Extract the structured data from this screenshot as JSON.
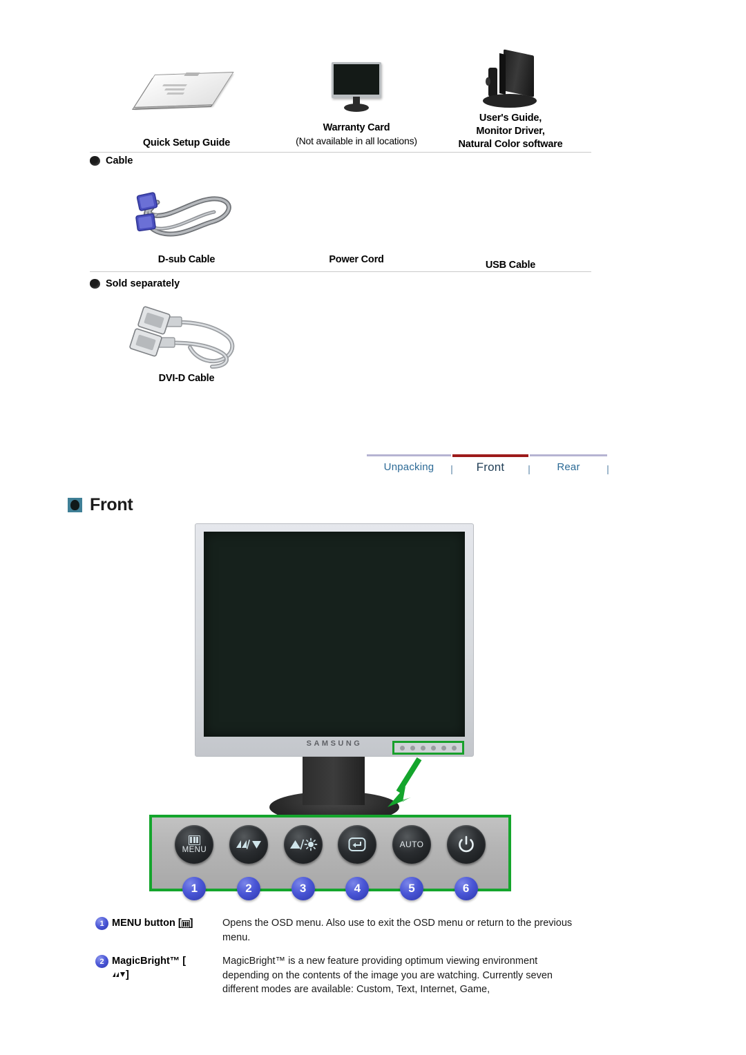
{
  "accessories": {
    "row1": [
      {
        "label": "Quick Setup Guide",
        "sub": "",
        "icon": "booklet-icon"
      },
      {
        "label": "Warranty Card",
        "sub": "(Not available in all locations)",
        "icon": "monitor-front-icon"
      },
      {
        "label": "User's Guide,\nMonitor Driver,\nNatural Color software",
        "sub": "",
        "icon": "monitor-angled-icon"
      }
    ],
    "row1_labels": {
      "quick_setup_guide": "Quick Setup Guide",
      "warranty_card": "Warranty Card",
      "warranty_card_note": "(Not available in all locations)",
      "users_guide_l1": "User's Guide,",
      "users_guide_l2": "Monitor Driver,",
      "users_guide_l3": "Natural Color software"
    },
    "cable_section": {
      "heading": "Cable",
      "items": {
        "dsub": "D-sub Cable",
        "power": "Power Cord",
        "usb": "USB Cable"
      }
    },
    "sold_separately_section": {
      "heading": "Sold separately",
      "items": {
        "dvi": "DVI-D Cable"
      }
    }
  },
  "nav": {
    "tabs": [
      {
        "label": "Unpacking",
        "active": false
      },
      {
        "label": "Front",
        "active": true
      },
      {
        "label": "Rear",
        "active": false
      }
    ],
    "colors": {
      "inactive_bar": "#b6b4d2",
      "active_bar": "#9d1b1b",
      "link": "#2c6a96",
      "active_text": "#1f3d55"
    }
  },
  "front_section": {
    "title": "Front",
    "monitor": {
      "brand": "SAMSUNG",
      "highlight_color": "#14a52c"
    },
    "controls": [
      {
        "num": "1",
        "caption": "MENU",
        "glyph": "menu-bars-icon"
      },
      {
        "num": "2",
        "caption": "",
        "glyph": "magicbright-down-icon"
      },
      {
        "num": "3",
        "caption": "",
        "glyph": "up-brightness-icon"
      },
      {
        "num": "4",
        "caption": "",
        "glyph": "enter-icon"
      },
      {
        "num": "5",
        "caption": "AUTO",
        "glyph": "auto-text"
      },
      {
        "num": "6",
        "caption": "",
        "glyph": "power-icon"
      }
    ],
    "descriptions": [
      {
        "num": "1",
        "term": "MENU button [",
        "term_tail": "]",
        "term_icon": "menu-bars-icon",
        "body": "Opens the OSD menu. Also use to exit the OSD menu or return to the previous menu."
      },
      {
        "num": "2",
        "term": "MagicBright™ [",
        "term_tail": "]",
        "term_icon": "magicbright-icon",
        "body": "MagicBright™ is a new feature providing optimum viewing environment depending on the contents of the image you are watching. Currently seven different modes are available: Custom, Text, Internet, Game,"
      }
    ]
  }
}
